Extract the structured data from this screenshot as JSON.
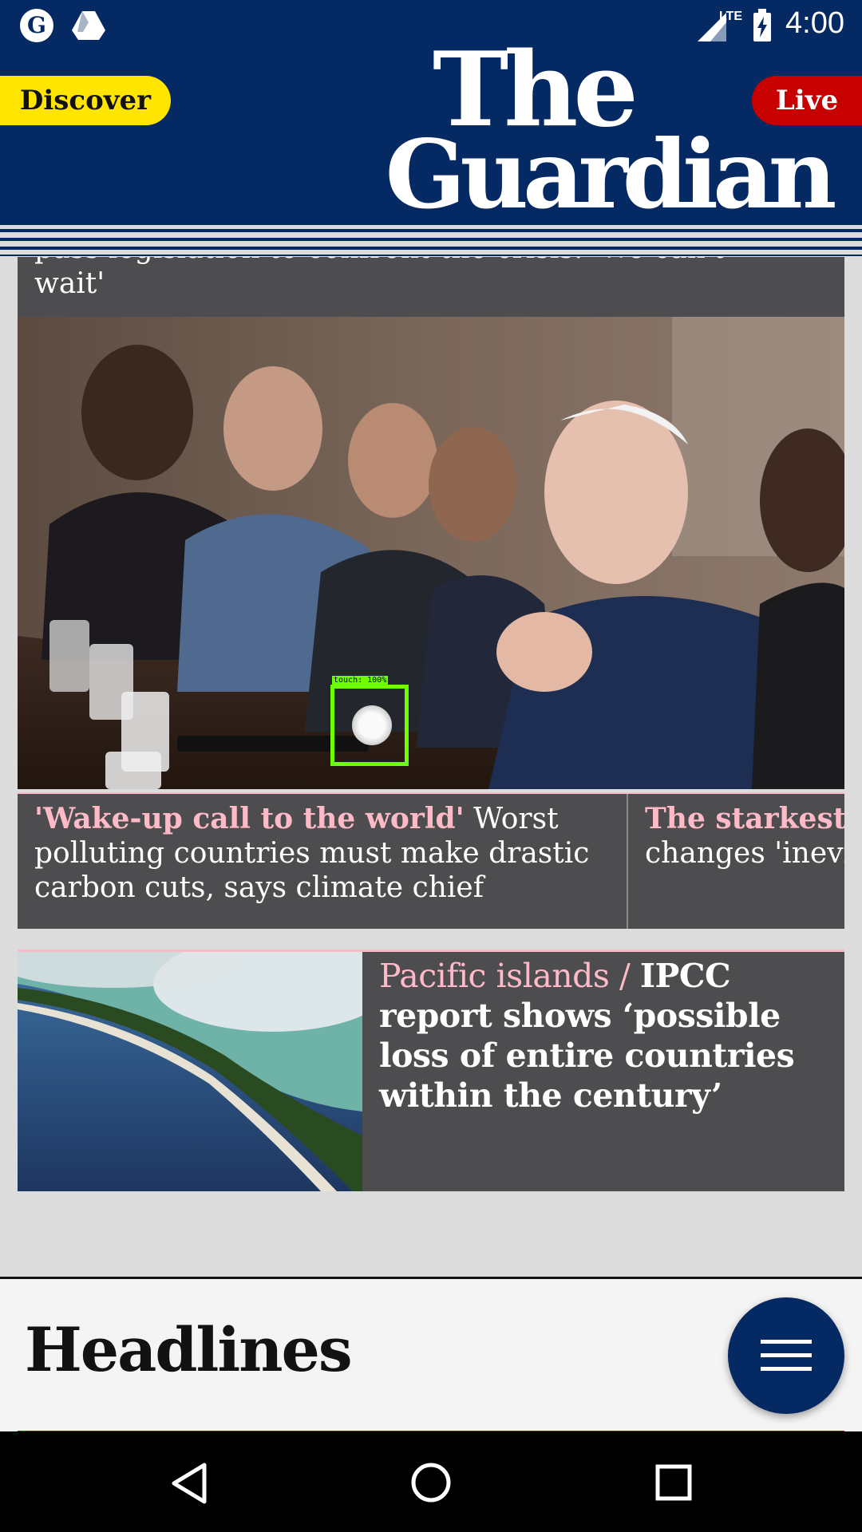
{
  "status_bar": {
    "time": "4:00",
    "network": "LTE",
    "left_icons": [
      "guardian-notification-icon",
      "drive-icon"
    ],
    "right_icons": [
      "signal-icon",
      "battery-charging-icon"
    ]
  },
  "header": {
    "discover_label": "Discover",
    "live_label": "Live",
    "logo_line1": "The",
    "logo_line2": "Guardian",
    "brand_color": "#052962",
    "discover_color": "#ffe500",
    "live_color": "#c70000"
  },
  "cards": {
    "card1_top_text": "pass legislation to confront the crisis: 'We can't wait'",
    "story_a": {
      "kicker": "'Wake-up call to the world'",
      "headline": " Worst polluting countries must make drastic carbon cuts, says climate chief"
    },
    "story_b": {
      "kicker": "The starkest w",
      "headline": "changes 'inevita"
    },
    "story_c": {
      "kicker": "Pacific islands / ",
      "headline": "IPCC report shows ‘possible loss of entire countries within the century’"
    },
    "kicker_color": "#ffbac8"
  },
  "touch_overlay": {
    "label": "touch: 100%"
  },
  "headlines": {
    "title": "Headlines"
  },
  "fab": {
    "icon": "hamburger-menu-icon"
  },
  "nav_bar": {
    "icons": [
      "back-icon",
      "home-icon",
      "recents-icon"
    ]
  }
}
